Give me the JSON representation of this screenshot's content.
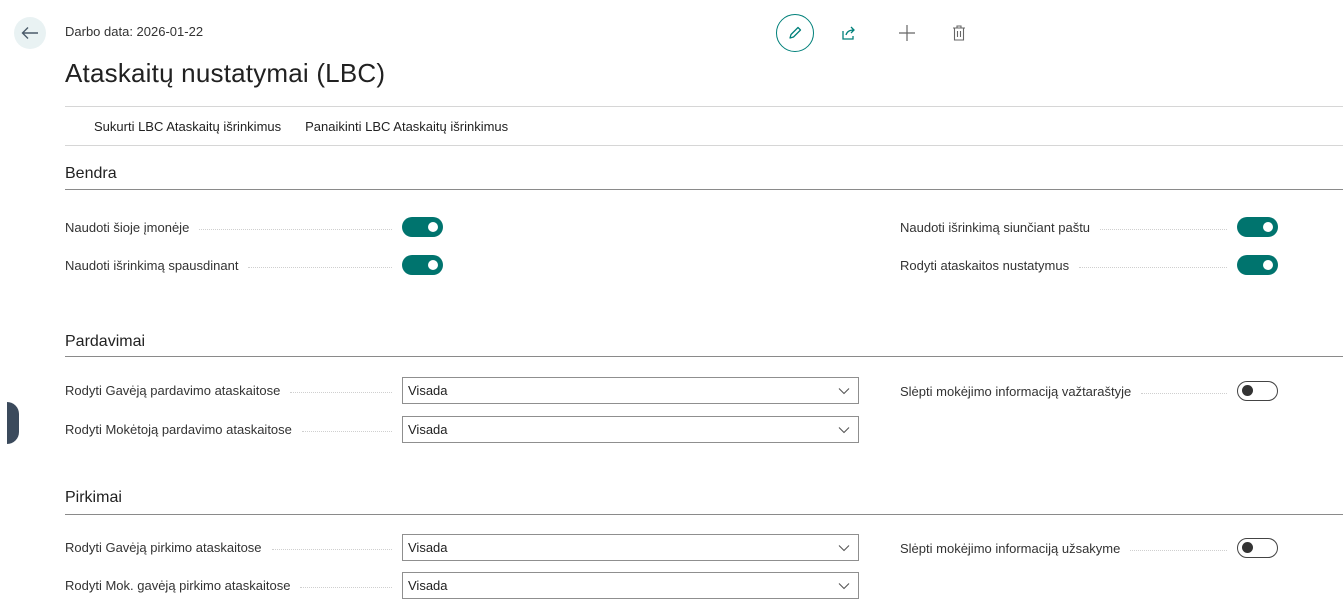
{
  "header": {
    "work_date": "Darbo data: 2026-01-22",
    "title": "Ataskaitų nustatymai (LBC)",
    "toolbar_icons": [
      "pencil-icon",
      "share-icon",
      "plus-icon",
      "trash-icon"
    ]
  },
  "actions": {
    "create": "Sukurti LBC Ataskaitų išrinkimus",
    "delete": "Panaikinti LBC Ataskaitų išrinkimus"
  },
  "sections": {
    "general": {
      "title": "Bendra",
      "use_in_company": {
        "label": "Naudoti šioje įmonėje",
        "value": true
      },
      "use_selection_printing": {
        "label": "Naudoti išrinkimą spausdinant",
        "value": true
      },
      "use_selection_email": {
        "label": "Naudoti išrinkimą siunčiant paštu",
        "value": true
      },
      "show_report_settings": {
        "label": "Rodyti ataskaitos nustatymus",
        "value": true
      }
    },
    "sales": {
      "title": "Pardavimai",
      "show_recipient": {
        "label": "Rodyti Gavėją pardavimo ataskaitose",
        "value": "Visada"
      },
      "show_payer": {
        "label": "Rodyti Mokėtoją pardavimo ataskaitose",
        "value": "Visada"
      },
      "hide_payment_info": {
        "label": "Slėpti mokėjimo informaciją važtaraštyje",
        "value": false
      }
    },
    "purchases": {
      "title": "Pirkimai",
      "show_recipient": {
        "label": "Rodyti Gavėją pirkimo ataskaitose",
        "value": "Visada"
      },
      "show_pay_recipient": {
        "label": "Rodyti Mok. gavėją pirkimo ataskaitose",
        "value": "Visada"
      },
      "hide_payment_info": {
        "label": "Slėpti mokėjimo informaciją užsakyme",
        "value": false
      }
    }
  },
  "colors": {
    "accent": "#00746e",
    "toggle_off_border": "#444444"
  }
}
